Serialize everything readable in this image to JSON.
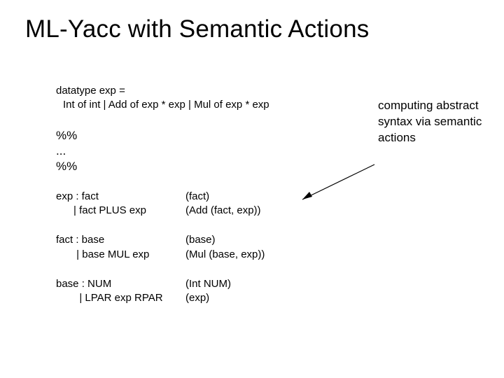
{
  "title": "ML-Yacc with Semantic Actions",
  "datatype": {
    "l1": "datatype exp =",
    "l2": "Int of int | Add of exp * exp | Mul of exp * exp"
  },
  "sep": {
    "a": "%%",
    "b": "...",
    "c": "%%"
  },
  "rules": [
    {
      "rows": [
        {
          "left": "exp : fact",
          "right": "(fact)"
        },
        {
          "left": "      | fact PLUS exp",
          "right": "(Add (fact, exp))"
        }
      ]
    },
    {
      "rows": [
        {
          "left": "fact : base",
          "right": "(base)"
        },
        {
          "left": "       | base MUL exp",
          "right": "(Mul (base, exp))"
        }
      ]
    },
    {
      "rows": [
        {
          "left": "base : NUM",
          "right": "(Int NUM)"
        },
        {
          "left": "        | LPAR exp RPAR",
          "right": "(exp)"
        }
      ]
    }
  ],
  "note": "computing abstract syntax via semantic actions"
}
